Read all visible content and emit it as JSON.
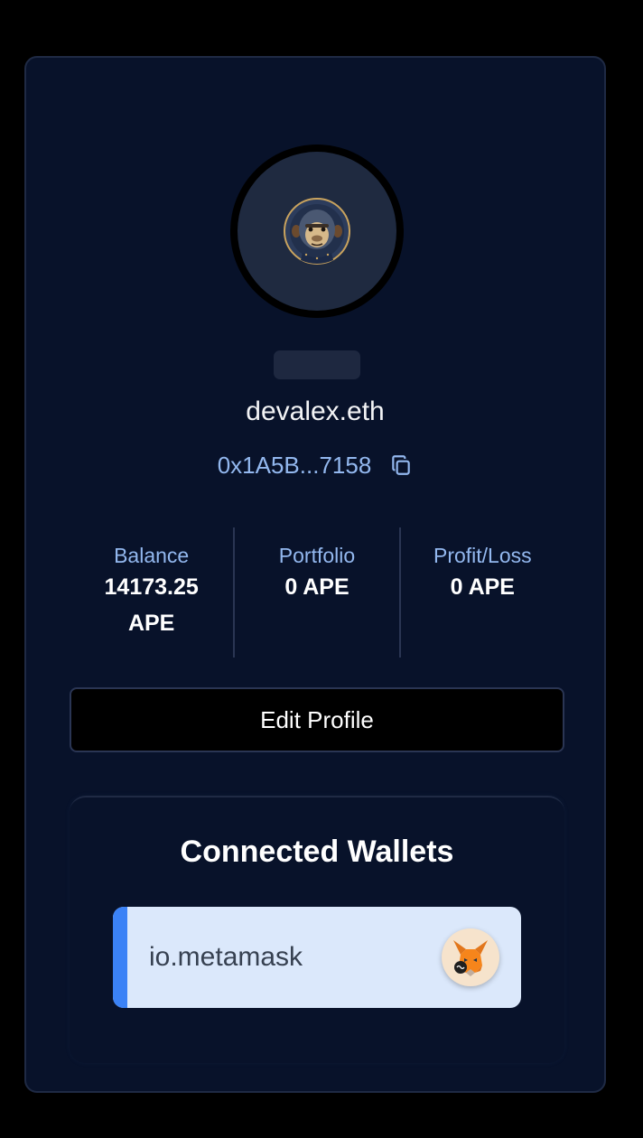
{
  "profile": {
    "username": "devalex.eth",
    "address": "0x1A5B...7158",
    "avatar_icon": "ape-avatar-icon"
  },
  "stats": [
    {
      "label": "Balance",
      "value": "14173.25 APE"
    },
    {
      "label": "Portfolio",
      "value": "0 APE"
    },
    {
      "label": "Profit/Loss",
      "value": "0 APE"
    }
  ],
  "actions": {
    "edit_profile_label": "Edit Profile"
  },
  "wallets": {
    "title": "Connected Wallets",
    "items": [
      {
        "label": "io.metamask",
        "icon": "metamask-fox-icon"
      }
    ]
  },
  "colors": {
    "page_background": "#000000",
    "card_background": "#08122a",
    "accent_text": "#93b8ef",
    "wallet_background": "#dbe8fb",
    "wallet_accent": "#3b82f6"
  }
}
